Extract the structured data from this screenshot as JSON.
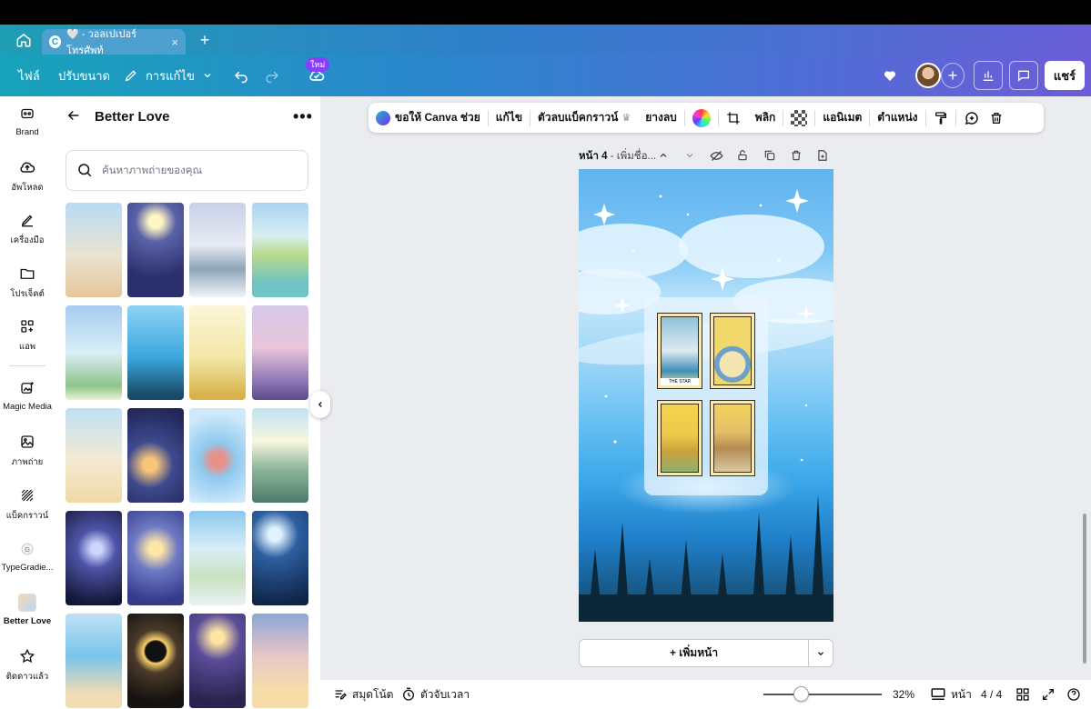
{
  "browser": {
    "tab_title": "🤍 - วอลเปเปอร์โทรศัพท์",
    "tab_favicon": "C"
  },
  "header": {
    "file": "ไฟล์",
    "resize": "ปรับขนาด",
    "edit_mode": "การแก้ไข",
    "new_badge": "ใหม่",
    "share": "แชร์"
  },
  "rail": {
    "items": [
      {
        "label": "Brand",
        "icon": "brand-icon"
      },
      {
        "label": "อัพโหลด",
        "icon": "upload-cloud-icon"
      },
      {
        "label": "เครื่องมือ",
        "icon": "draw-tool-icon"
      },
      {
        "label": "โปรเจ็คต์",
        "icon": "folder-icon"
      },
      {
        "label": "แอพ",
        "icon": "apps-icon"
      },
      {
        "label": "Magic Media",
        "icon": "magic-media-icon"
      },
      {
        "label": "ภาพถ่าย",
        "icon": "photo-icon"
      },
      {
        "label": "แบ็คกราวน์",
        "icon": "background-icon"
      },
      {
        "label": "TypeGradie...",
        "icon": "typegradient-icon"
      },
      {
        "label": "Better Love",
        "icon": "better-love-app-icon"
      },
      {
        "label": "ติดดาวแล้ว",
        "icon": "star-icon"
      }
    ]
  },
  "panel": {
    "title": "Better Love",
    "search_placeholder": "ค้นหาภาพถ่ายของคุณ"
  },
  "toolbar": {
    "ask_canva": "ขอให้ Canva ช่วย",
    "edit": "แก้ไข",
    "bg_remover": "ตัวลบแบ็คกราวน์",
    "eraser": "ยางลบ",
    "flip": "พลิก",
    "animate": "แอนิเมต",
    "position": "ตำแหน่ง"
  },
  "page": {
    "label_prefix": "หน้า 4",
    "label_suffix": " - เพิ่มชื่อ..."
  },
  "design": {
    "cards": [
      "THE STAR",
      "",
      "",
      ""
    ]
  },
  "add_page": {
    "label": "+ เพิ่มหน้า"
  },
  "bottom": {
    "notes": "สมุดโน้ต",
    "timer": "ตัวจับเวลา",
    "zoom": "32%",
    "zoom_level": 0.32,
    "pages_label": "หน้า",
    "page_count": "4 / 4"
  },
  "colors": {
    "accent": "#8b3dff",
    "header_start": "#18a3bb",
    "header_end": "#6d5cd8"
  }
}
